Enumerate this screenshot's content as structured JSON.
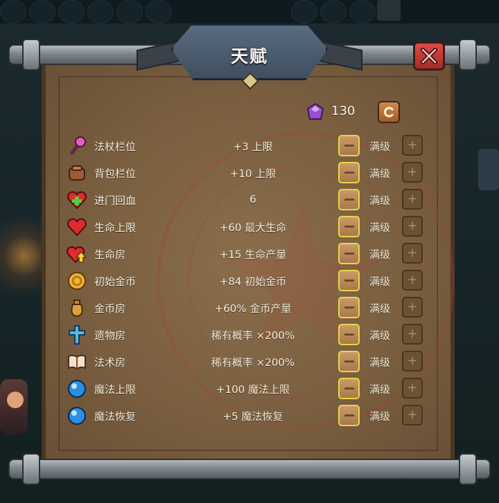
{
  "title": "天赋",
  "currency": {
    "icon": "purple-gem-icon",
    "value": "130"
  },
  "refresh_icon": "refresh-icon",
  "close_icon": "close-x-icon",
  "colors": {
    "parchment": "#7a5f40",
    "minus_border": "#e8d64a",
    "button_orange": "#c99a66",
    "close_red": "#d43a35",
    "text": "#f3ecdc"
  },
  "talents": [
    {
      "icon": "wand-icon",
      "name": "法杖栏位",
      "value": "+3 上限",
      "level": "满级"
    },
    {
      "icon": "backpack-icon",
      "name": "背包栏位",
      "value": "+10 上限",
      "level": "满级"
    },
    {
      "icon": "heart-plus-icon",
      "name": "进门回血",
      "value": "6",
      "level": "满级"
    },
    {
      "icon": "heart-icon",
      "name": "生命上限",
      "value": "+60 最大生命",
      "level": "满级"
    },
    {
      "icon": "heart-arrow-icon",
      "name": "生命房",
      "value": "+15 生命产量",
      "level": "满级"
    },
    {
      "icon": "coin-icon",
      "name": "初始金币",
      "value": "+84 初始金币",
      "level": "满级"
    },
    {
      "icon": "money-bag-icon",
      "name": "金币房",
      "value": "+60% 金币产量",
      "level": "满级"
    },
    {
      "icon": "cross-icon",
      "name": "遗物房",
      "value": "稀有概率 ×200%",
      "level": "满级"
    },
    {
      "icon": "spellbook-icon",
      "name": "法术房",
      "value": "稀有概率 ×200%",
      "level": "满级"
    },
    {
      "icon": "mana-orb-icon",
      "name": "魔法上限",
      "value": "+100 魔法上限",
      "level": "满级"
    },
    {
      "icon": "mana-orb-icon",
      "name": "魔法恢复",
      "value": "+5 魔法恢复",
      "level": "满级"
    }
  ]
}
